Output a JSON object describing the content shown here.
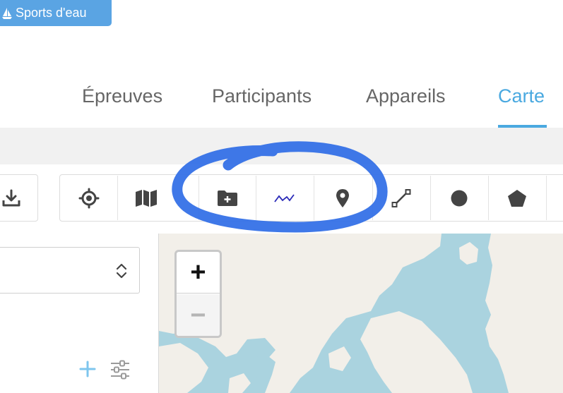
{
  "badge": {
    "label": "Sports d'eau",
    "icon": "sailboat-icon"
  },
  "tabs": [
    {
      "label": "Épreuves",
      "active": false
    },
    {
      "label": "Participants",
      "active": false
    },
    {
      "label": "Appareils",
      "active": false
    },
    {
      "label": "Carte",
      "active": true
    }
  ],
  "toolbar": {
    "left_group": [
      "download-icon"
    ],
    "main_group": [
      "crosshair-locate-icon",
      "map-layers-icon",
      "add-folder-icon",
      "route-line-icon",
      "map-marker-icon",
      "draw-line-icon",
      "draw-circle-icon",
      "draw-polygon-icon"
    ]
  },
  "sidebar": {
    "select_value": "",
    "add_icon": "plus-icon",
    "settings_icon": "sliders-icon"
  },
  "map": {
    "zoom_in_label": "+",
    "zoom_out_label": "−"
  },
  "colors": {
    "accent": "#4aa9e0",
    "badge": "#5aa4e3",
    "water": "#aad3df",
    "land": "#f2efe9",
    "highlight_stroke": "#2f6de6"
  }
}
